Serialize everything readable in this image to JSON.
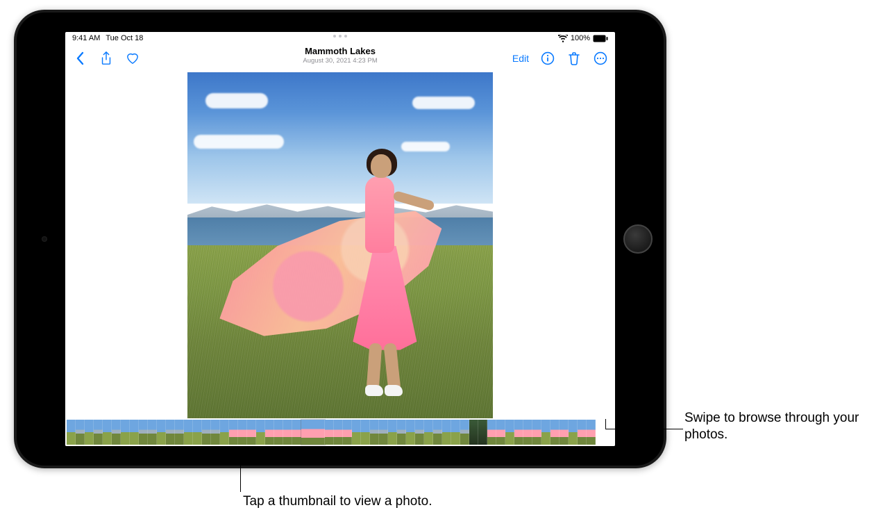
{
  "status": {
    "time": "9:41 AM",
    "date": "Tue Oct 18",
    "battery_pct": "100%"
  },
  "header": {
    "title": "Mammoth Lakes",
    "subtitle": "August 30, 2021  4:23 PM",
    "edit_label": "Edit"
  },
  "callouts": {
    "swipe": "Swipe to browse through your photos.",
    "tap": "Tap a thumbnail to view a photo."
  }
}
